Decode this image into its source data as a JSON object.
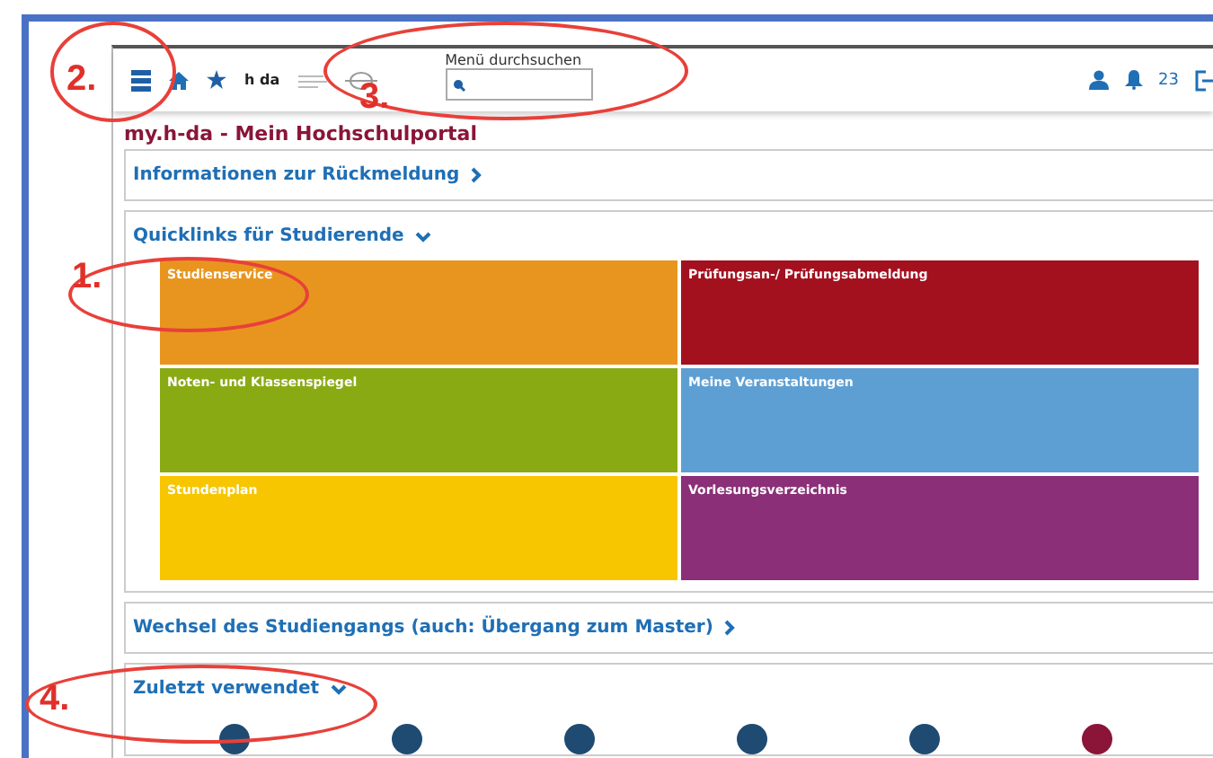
{
  "header": {
    "logo_text": "h da",
    "search": {
      "label": "Menü durchsuchen"
    },
    "notification_count": "23"
  },
  "portal_title": "my.h-da - Mein Hochschulportal",
  "sections": [
    {
      "title": "Informationen zur Rückmeldung",
      "expanded": false
    },
    {
      "title": "Quicklinks für Studierende",
      "expanded": true,
      "tiles": [
        {
          "label": "Studienservice",
          "color": "#e8951f"
        },
        {
          "label": "Prüfungsan-/ Prüfungsabmeldung",
          "color": "#a3111f"
        },
        {
          "label": "Noten- und Klassenspiegel",
          "color": "#8aaa14"
        },
        {
          "label": "Meine Veranstaltungen",
          "color": "#5e9fd3"
        },
        {
          "label": "Stundenplan",
          "color": "#f7c600"
        },
        {
          "label": "Vorlesungsverzeichnis",
          "color": "#8b2f78"
        }
      ]
    },
    {
      "title": "Wechsel des Studiengangs (auch: Übergang zum Master)",
      "expanded": false
    },
    {
      "title": "Zuletzt verwendet",
      "expanded": true,
      "recent": [
        {
          "color": "#1f4b72"
        },
        {
          "color": "#1f4b72"
        },
        {
          "color": "#1f4b72"
        },
        {
          "color": "#1f4b72"
        },
        {
          "color": "#1f4b72"
        },
        {
          "color": "#8a1538"
        }
      ]
    }
  ],
  "annotations": [
    {
      "label": "2."
    },
    {
      "label": "3."
    },
    {
      "label": "1."
    },
    {
      "label": "4."
    }
  ]
}
